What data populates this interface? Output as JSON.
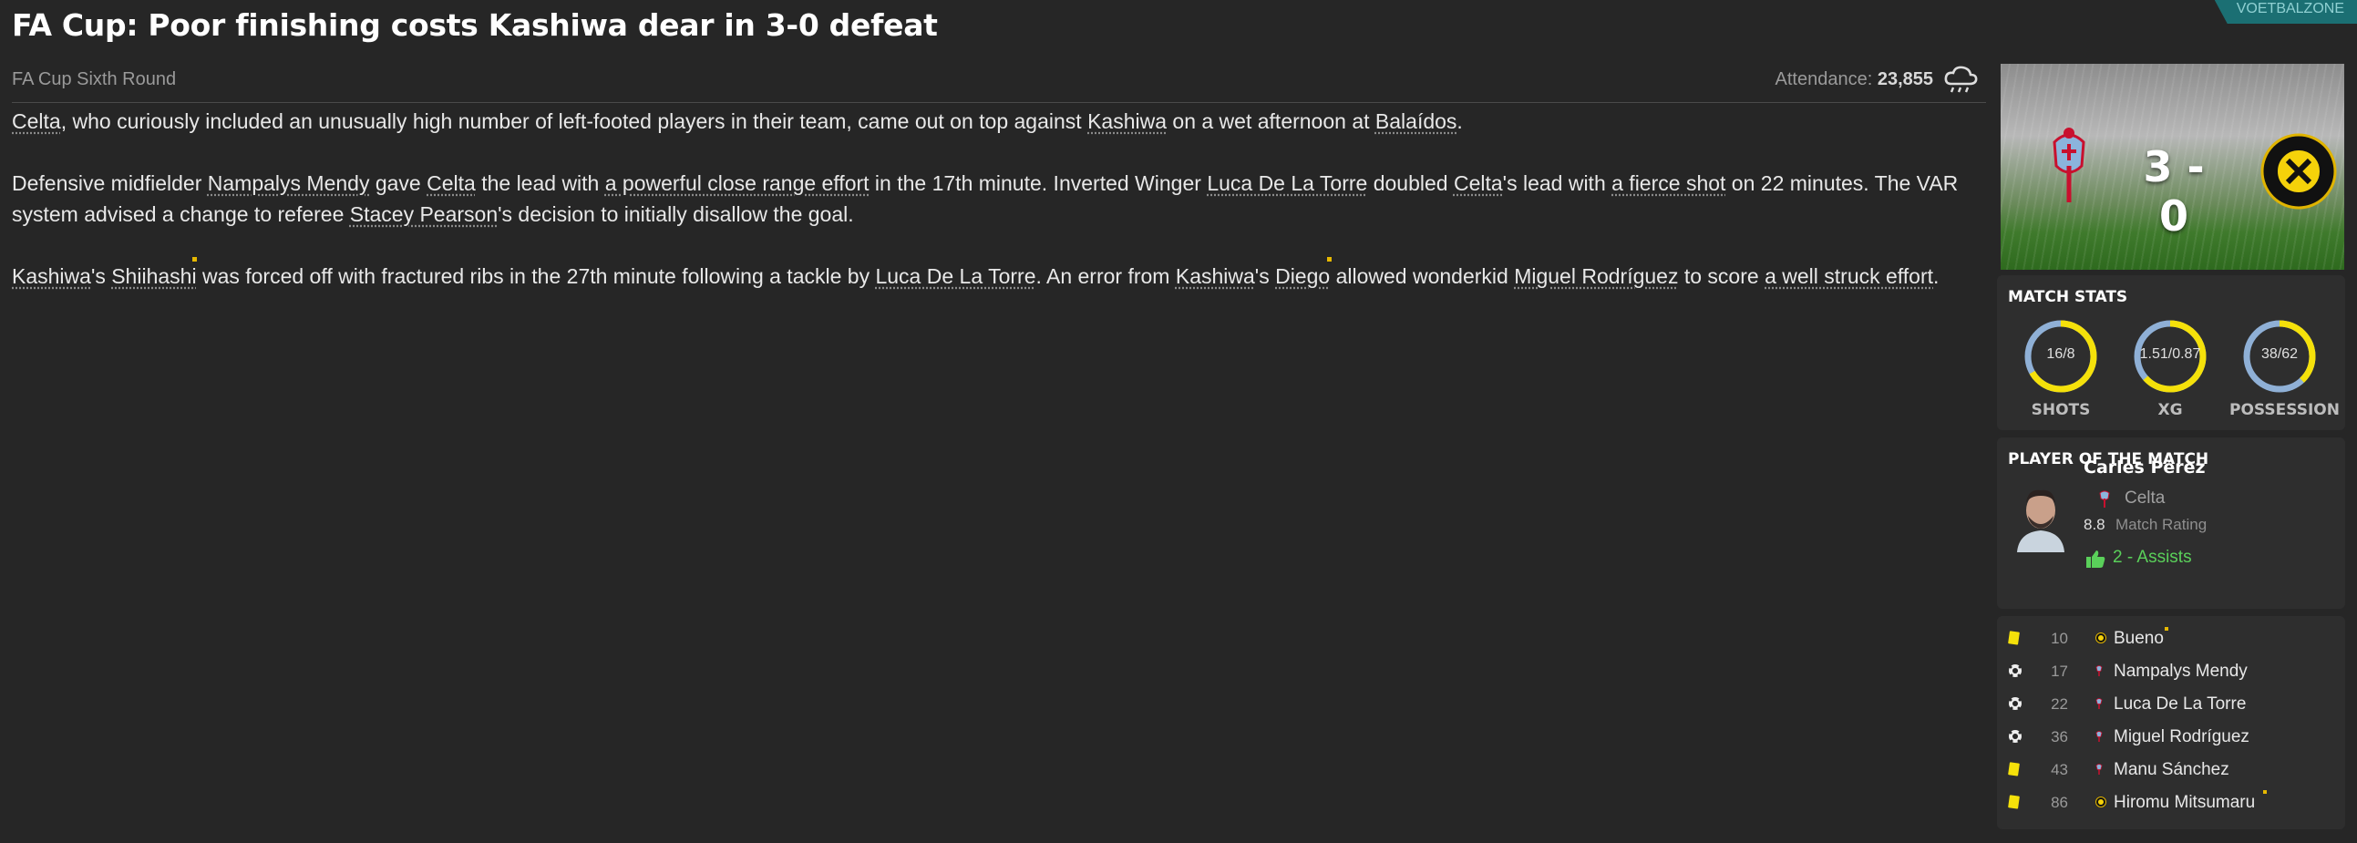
{
  "headline": "FA Cup: Poor finishing costs Kashiwa dear in 3-0 defeat",
  "brand_tag": "VOETBALZONE",
  "round": "FA Cup Sixth Round",
  "attendance_label": "Attendance:",
  "attendance_value": "23,855",
  "weather_icon": "rain-cloud-icon",
  "article": {
    "p1": [
      {
        "t": "Celta",
        "u": true
      },
      {
        "t": ", who curiously included an unusually high number of left-footed players in their team, came out on top against "
      },
      {
        "t": "Kashiwa",
        "u": true
      },
      {
        "t": " on a wet afternoon at "
      },
      {
        "t": "Balaídos",
        "u": true
      },
      {
        "t": "."
      }
    ],
    "p2": [
      {
        "t": "Defensive midfielder "
      },
      {
        "t": "Nampalys Mendy",
        "u": true
      },
      {
        "t": " gave "
      },
      {
        "t": "Celta",
        "u": true
      },
      {
        "t": " the lead with "
      },
      {
        "t": "a powerful close range effort",
        "u": true
      },
      {
        "t": " in the 17th minute. Inverted Winger "
      },
      {
        "t": "Luca De La Torre",
        "u": true
      },
      {
        "t": " doubled "
      },
      {
        "t": "Celta",
        "u": true
      },
      {
        "t": "'s lead with "
      },
      {
        "t": "a fierce shot",
        "u": true
      },
      {
        "t": " on 22 minutes. The VAR system advised a change to referee "
      },
      {
        "t": "Stacey Pearson",
        "u": true
      },
      {
        "t": "'s decision to initially disallow the goal."
      }
    ],
    "p3": [
      {
        "t": "Kashiwa",
        "u": true
      },
      {
        "t": "'s "
      },
      {
        "t": "Shiihashi",
        "u": true
      },
      {
        "t": " was forced off with fractured ribs in the 27th minute following a tackle by "
      },
      {
        "t": "Luca De La Torre",
        "u": true
      },
      {
        "t": ". An error from "
      },
      {
        "t": "Kashiwa",
        "u": true
      },
      {
        "t": "'s "
      },
      {
        "t": "Diego",
        "u": true
      },
      {
        "t": " allowed wonderkid "
      },
      {
        "t": "Miguel Rodríguez",
        "u": true
      },
      {
        "t": " to score "
      },
      {
        "t": "a well struck effort",
        "u": true
      },
      {
        "t": "."
      }
    ]
  },
  "score": "3 - 0",
  "colors": {
    "accent_yellow": "#f5e10a",
    "ring_blue": "#8fb0d6",
    "green": "#5ad05a"
  },
  "match_stats": {
    "title": "MATCH STATS",
    "items": [
      {
        "label": "SHOTS",
        "value": "16/8",
        "home_share": 0.667
      },
      {
        "label": "XG",
        "value": "1.51/0.87",
        "home_share": 0.634
      },
      {
        "label": "POSSESSION",
        "value": "38/62",
        "home_share": 0.38
      }
    ]
  },
  "potm": {
    "title": "PLAYER OF THE MATCH",
    "name": "Carles Pérez",
    "club": "Celta",
    "rating": "8.8",
    "rating_label": "Match Rating",
    "assists": "2 - Assists"
  },
  "events": [
    {
      "minute": "10",
      "type": "yellow-card-icon",
      "team": "kashiwa",
      "player": "Bueno"
    },
    {
      "minute": "17",
      "type": "goal-ball-icon",
      "team": "celta",
      "player": "Nampalys Mendy"
    },
    {
      "minute": "22",
      "type": "goal-ball-icon",
      "team": "celta",
      "player": "Luca De La Torre"
    },
    {
      "minute": "36",
      "type": "goal-ball-icon",
      "team": "celta",
      "player": "Miguel Rodríguez"
    },
    {
      "minute": "43",
      "type": "yellow-card-icon",
      "team": "celta",
      "player": "Manu Sánchez"
    },
    {
      "minute": "86",
      "type": "yellow-card-icon",
      "team": "kashiwa",
      "player": "Hiromu Mitsumaru"
    }
  ]
}
